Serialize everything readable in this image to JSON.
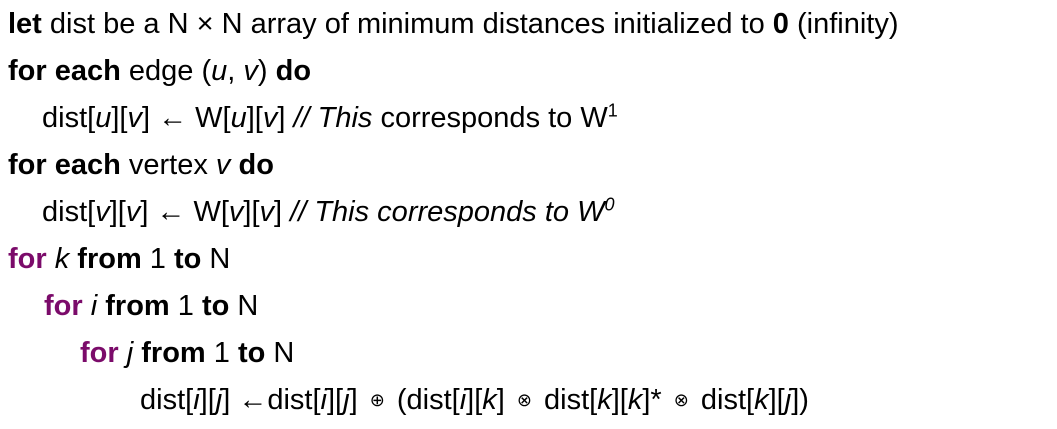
{
  "lines": [
    {
      "indent": 0,
      "parts": [
        {
          "text": "let",
          "b": true
        },
        {
          "text": " dist be a N × N array of minimum distances initialized to "
        },
        {
          "text": "0",
          "b": true
        },
        {
          "text": " (infinity)"
        }
      ]
    },
    {
      "indent": 0,
      "parts": [
        {
          "text": "for each",
          "b": true
        },
        {
          "text": " edge ("
        },
        {
          "text": "u",
          "i": true
        },
        {
          "text": ", "
        },
        {
          "text": "v",
          "i": true
        },
        {
          "text": ") "
        },
        {
          "text": "do",
          "b": true
        }
      ]
    },
    {
      "indent": 1,
      "parts": [
        {
          "text": "dist["
        },
        {
          "text": "u",
          "i": true
        },
        {
          "text": "]["
        },
        {
          "text": "v",
          "i": true
        },
        {
          "text": "] ← W["
        },
        {
          "text": "u",
          "i": true
        },
        {
          "text": "]["
        },
        {
          "text": "v",
          "i": true
        },
        {
          "text": "]  "
        },
        {
          "text": "// This",
          "i": true
        },
        {
          "text": " corresponds to W"
        },
        {
          "text": "1",
          "sup": true
        }
      ]
    },
    {
      "indent": 0,
      "parts": [
        {
          "text": "for each",
          "b": true
        },
        {
          "text": " vertex "
        },
        {
          "text": "v",
          "i": true
        },
        {
          "text": " "
        },
        {
          "text": "do",
          "b": true
        }
      ]
    },
    {
      "indent": 1,
      "parts": [
        {
          "text": "dist["
        },
        {
          "text": "v",
          "i": true
        },
        {
          "text": "]["
        },
        {
          "text": "v",
          "i": true
        },
        {
          "text": "] ← W["
        },
        {
          "text": "v",
          "i": true
        },
        {
          "text": "]["
        },
        {
          "text": "v",
          "i": true
        },
        {
          "text": "] "
        },
        {
          "text": "// This corresponds to W",
          "i": true
        },
        {
          "text": "0",
          "i": true,
          "sup": true
        }
      ]
    },
    {
      "indent": 0,
      "parts": [
        {
          "text": "for",
          "b": true,
          "purple": true
        },
        {
          "text": " "
        },
        {
          "text": "k",
          "i": true
        },
        {
          "text": " "
        },
        {
          "text": "from",
          "b": true
        },
        {
          "text": " 1 "
        },
        {
          "text": "to",
          "b": true
        },
        {
          "text": " N"
        }
      ]
    },
    {
      "indent": 2,
      "parts": [
        {
          "text": "for",
          "b": true,
          "purple": true
        },
        {
          "text": " "
        },
        {
          "text": "i",
          "i": true
        },
        {
          "text": " "
        },
        {
          "text": "from",
          "b": true
        },
        {
          "text": " 1 "
        },
        {
          "text": "to",
          "b": true
        },
        {
          "text": " N"
        }
      ]
    },
    {
      "indent": 3,
      "parts": [
        {
          "text": "for",
          "b": true,
          "purple": true
        },
        {
          "text": " "
        },
        {
          "text": "j",
          "i": true
        },
        {
          "text": " "
        },
        {
          "text": "from",
          "b": true
        },
        {
          "text": " 1 "
        },
        {
          "text": "to",
          "b": true
        },
        {
          "text": " N"
        }
      ]
    },
    {
      "indent": 4,
      "parts": [
        {
          "text": "dist["
        },
        {
          "text": "i",
          "i": true
        },
        {
          "text": "]["
        },
        {
          "text": "j",
          "i": true
        },
        {
          "text": "] ←dist["
        },
        {
          "text": "i",
          "i": true
        },
        {
          "text": "]["
        },
        {
          "text": "j",
          "i": true
        },
        {
          "text": "] "
        },
        {
          "text": "⊕",
          "op": true
        },
        {
          "text": " (dist["
        },
        {
          "text": "i",
          "i": true
        },
        {
          "text": "]["
        },
        {
          "text": "k",
          "i": true
        },
        {
          "text": "] "
        },
        {
          "text": "⊗",
          "op": true
        },
        {
          "text": " dist["
        },
        {
          "text": "k",
          "i": true
        },
        {
          "text": "]["
        },
        {
          "text": "k",
          "i": true
        },
        {
          "text": "]* "
        },
        {
          "text": "⊗",
          "op": true
        },
        {
          "text": " dist["
        },
        {
          "text": "k",
          "i": true
        },
        {
          "text": "]["
        },
        {
          "text": "j",
          "i": true
        },
        {
          "text": "])"
        }
      ]
    }
  ],
  "colors": {
    "text": "#000000",
    "keyword_for": "#7b0b6a",
    "background": "#ffffff"
  }
}
